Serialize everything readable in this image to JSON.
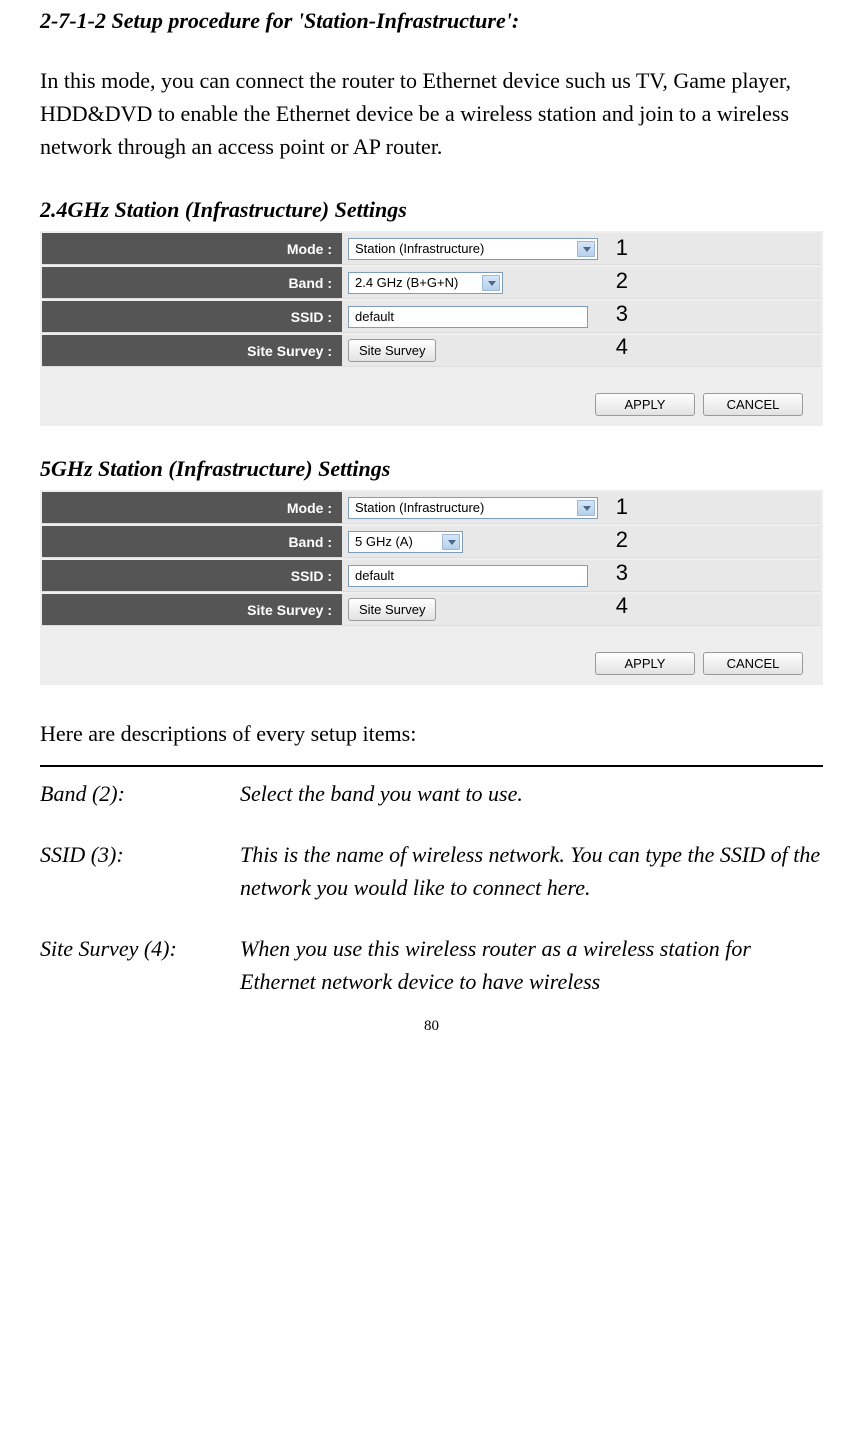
{
  "section_title": "2-7-1-2 Setup procedure for 'Station-Infrastructure':",
  "intro": "In this mode, you can connect the router to Ethernet device such us TV, Game player, HDD&DVD to enable the Ethernet device be a wireless station and join to a wireless network through an access point or AP router.",
  "panel24": {
    "title": "2.4GHz Station (Infrastructure) Settings",
    "rows": {
      "mode": {
        "label": "Mode :",
        "value": "Station (Infrastructure)"
      },
      "band": {
        "label": "Band :",
        "value": "2.4 GHz (B+G+N)"
      },
      "ssid": {
        "label": "SSID :",
        "value": "default"
      },
      "survey": {
        "label": "Site Survey :",
        "button": "Site Survey"
      }
    },
    "apply": "APPLY",
    "cancel": "CANCEL",
    "annotations": [
      "1",
      "2",
      "3",
      "4"
    ]
  },
  "panel5": {
    "title": "5GHz Station (Infrastructure) Settings",
    "rows": {
      "mode": {
        "label": "Mode :",
        "value": "Station (Infrastructure)"
      },
      "band": {
        "label": "Band :",
        "value": "5 GHz (A)"
      },
      "ssid": {
        "label": "SSID :",
        "value": "default"
      },
      "survey": {
        "label": "Site Survey :",
        "button": "Site Survey"
      }
    },
    "apply": "APPLY",
    "cancel": "CANCEL",
    "annotations": [
      "1",
      "2",
      "3",
      "4"
    ]
  },
  "descriptions_intro": "Here are descriptions of every setup items:",
  "descriptions": [
    {
      "label": "Band (2):",
      "value": "Select the band you want to use."
    },
    {
      "label": "SSID (3):",
      "value": "This is the name of wireless network. You can type the SSID of the network you would like to connect here."
    },
    {
      "label": "Site Survey (4):",
      "value": "When you use this wireless router as a wireless station for Ethernet network device to have wireless"
    }
  ],
  "page_number": "80"
}
